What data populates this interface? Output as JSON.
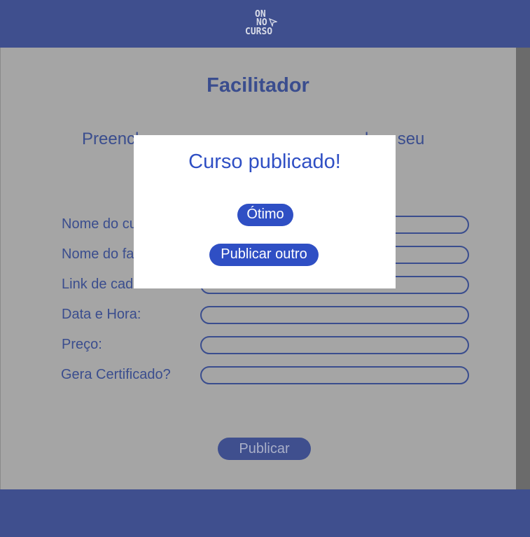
{
  "logo": {
    "line1": "ON",
    "line2": "NO",
    "line3": "CURSO",
    "icon": "cursor-arrow-icon"
  },
  "page": {
    "title": "Facilitador",
    "subtitle_left": "Preench",
    "subtitle_right": "lgar seu"
  },
  "form": {
    "fields": [
      {
        "label": "Nome do cu",
        "value": ""
      },
      {
        "label": "Nome do fa",
        "value": ""
      },
      {
        "label": "Link de cad",
        "value": ""
      },
      {
        "label": "Data e Hora:",
        "value": ""
      },
      {
        "label": "Preço:",
        "value": ""
      },
      {
        "label": "Gera Certificado?",
        "value": ""
      }
    ],
    "submit_label": "Publicar"
  },
  "modal": {
    "title": "Curso publicado!",
    "ok_label": "Ótimo",
    "again_label": "Publicar outro"
  },
  "colors": {
    "header": "#3f4f8e",
    "overlay_bg": "#a5a5a5",
    "modal_accent": "#2f4fc4",
    "text_primary": "#3a4d8e"
  }
}
